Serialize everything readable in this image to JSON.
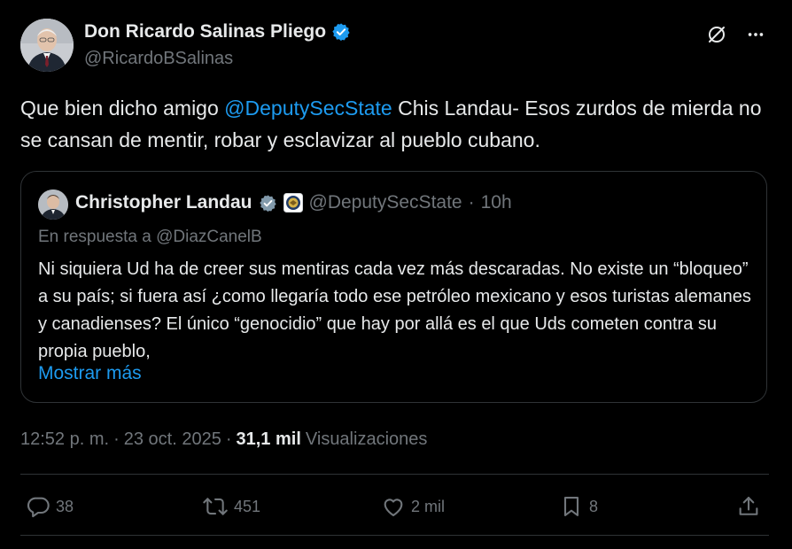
{
  "author": {
    "name": "Don Ricardo Salinas Pliego",
    "handle": "@RicardoBSalinas",
    "verified_icon": "verified-badge-icon"
  },
  "header_icons": [
    "grok-icon",
    "more-icon"
  ],
  "tweet": {
    "text_before": "Que bien dicho amigo ",
    "mention": "@DeputySecState",
    "text_after": " Chis Landau- Esos zurdos de mierda no se cansan de mentir, robar y esclavizar al pueblo cubano."
  },
  "quote": {
    "name": "Christopher Landau",
    "handle": "@DeputySecState",
    "separator": "·",
    "time": "10h",
    "reply_to": "En respuesta a @DiazCanelB",
    "text": "Ni siquiera Ud ha de creer sus mentiras cada vez más descaradas. No existe un “bloqueo” a su país; si fuera así ¿como llegaría todo ese petróleo mexicano y esos turistas alemanes y canadienses? El único “genocidio” que hay por allá es el que Uds cometen contra su propia pueblo,",
    "show_more": "Mostrar más"
  },
  "meta": {
    "time": "12:52 p. m.",
    "sep1": "·",
    "date": "23 oct. 2025",
    "sep2": "·",
    "views_count": "31,1 mil",
    "views_label": "Visualizaciones"
  },
  "actions": {
    "replies": "38",
    "reposts": "451",
    "likes": "2 mil",
    "bookmarks": "8"
  },
  "colors": {
    "background": "#000000",
    "text": "#e7e9ea",
    "muted": "#71767b",
    "accent": "#1d9bf0",
    "border": "#2f3336",
    "gold_badge": "#d4b145"
  }
}
